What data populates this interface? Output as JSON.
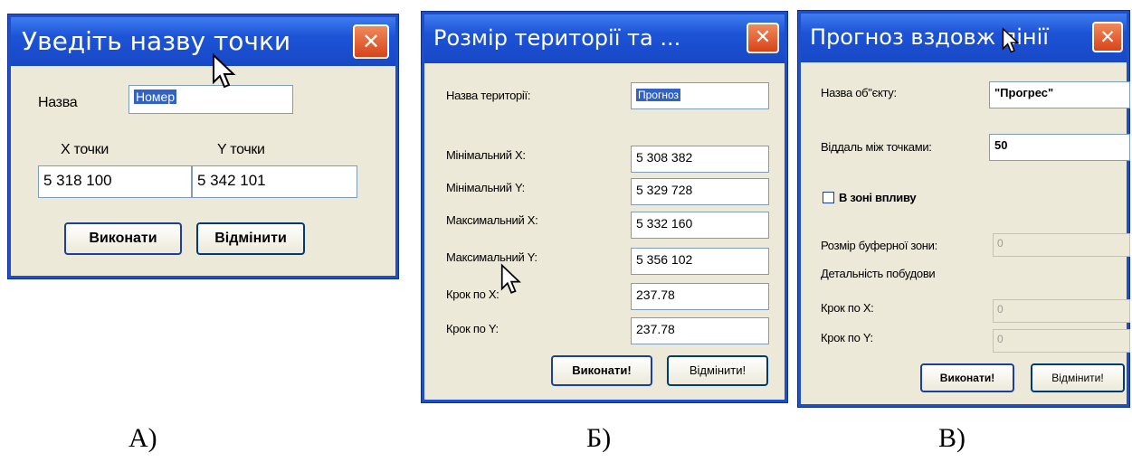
{
  "dialog_a": {
    "title": "Уведіть назву точки",
    "close_symbol": "✕",
    "name_label": "Назва",
    "name_value": "Номер",
    "x_label": "X точки",
    "y_label": "Y точки",
    "x_value": "5 318 100",
    "y_value": "5 342 101",
    "ok_label": "Виконати",
    "cancel_label": "Відмінити",
    "caption": "А)"
  },
  "dialog_b": {
    "title": "Розмір території та ...",
    "close_symbol": "✕",
    "territory_label": "Назва території:",
    "territory_value": "Прогноз",
    "rows": [
      {
        "label": "Мінімальний X:",
        "value": "5 308 382"
      },
      {
        "label": "Мінімальний Y:",
        "value": "5 329 728"
      },
      {
        "label": "Максимальний X:",
        "value": "5 332 160"
      },
      {
        "label": "Максимальний Y:",
        "value": "5 356 102"
      },
      {
        "label": "Крок по X:",
        "value": "237.78"
      },
      {
        "label": "Крок по Y:",
        "value": "237.78"
      }
    ],
    "ok_label": "Виконати!",
    "cancel_label": "Відмінити!",
    "caption": "Б)"
  },
  "dialog_c": {
    "title": "Прогноз вздовж лінії",
    "close_symbol": "✕",
    "object_label": "Назва об\"єкту:",
    "object_value": "\"Прогрес\"",
    "distance_label": "Віддаль між точками:",
    "distance_value": "50",
    "influence_label": "В зоні впливу",
    "buffer_label": "Розмір буферної зони:",
    "buffer_value": "0",
    "detail_label": "Детальність побудови",
    "step_x_label": "Крок по X:",
    "step_x_value": "0",
    "step_y_label": "Крок по Y:",
    "step_y_value": "0",
    "ok_label": "Виконати!",
    "cancel_label": "Відмінити!",
    "caption": "В)"
  }
}
